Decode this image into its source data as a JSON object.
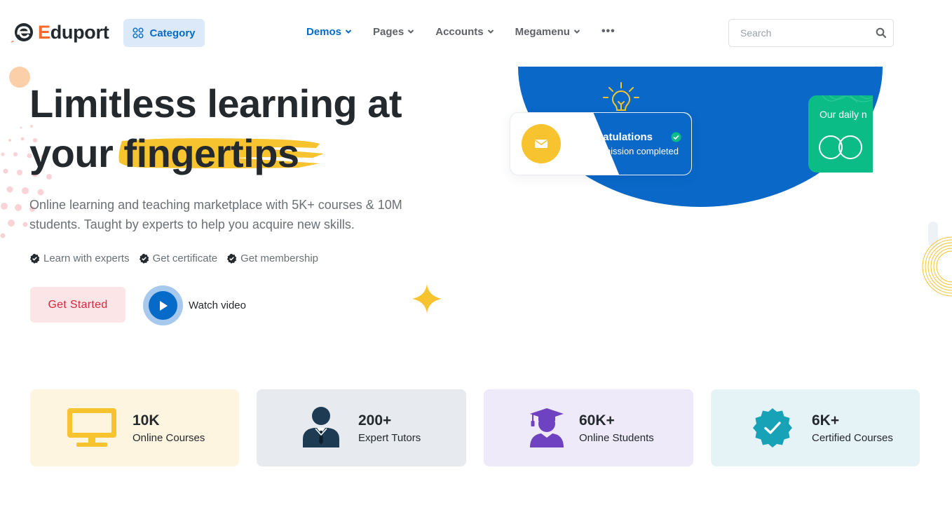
{
  "header": {
    "logo_prefix": "E",
    "logo_rest": "duport",
    "category_label": "Category",
    "nav": [
      {
        "label": "Demos",
        "active": true
      },
      {
        "label": "Pages",
        "active": false
      },
      {
        "label": "Accounts",
        "active": false
      },
      {
        "label": "Megamenu",
        "active": false
      }
    ],
    "more_label": "•••",
    "search_placeholder": "Search"
  },
  "hero": {
    "title_line1": "Limitless learning at",
    "title_word": "your",
    "title_highlight": "fingertips",
    "description": "Online learning and teaching marketplace with 5K+ courses & 10M students. Taught by experts to help you acquire new skills.",
    "features": [
      "Learn with experts",
      "Get certificate",
      "Get membership"
    ],
    "cta_label": "Get Started",
    "video_label": "Watch video"
  },
  "graphic": {
    "congrats_title": "Congratulations",
    "congrats_sub": "Your admission completed",
    "daily_label": "Our daily n"
  },
  "stats": [
    {
      "value": "10K",
      "label": "Online Courses",
      "icon": "monitor-icon",
      "bg": "#fef5e0"
    },
    {
      "value": "200+",
      "label": "Expert Tutors",
      "icon": "tutor-icon",
      "bg": "#e7eaee"
    },
    {
      "value": "60K+",
      "label": "Online Students",
      "icon": "graduate-icon",
      "bg": "#efeafa"
    },
    {
      "value": "6K+",
      "label": "Certified Courses",
      "icon": "certified-badge-icon",
      "bg": "#e5f3f7"
    }
  ],
  "colors": {
    "primary": "#066ac9",
    "accent_orange": "#f7692c",
    "warning": "#f7c32e",
    "success": "#0cbc87",
    "danger": "#d6293e",
    "purple": "#6f42c1",
    "info": "#17a2b8",
    "dark": "#24292d"
  }
}
